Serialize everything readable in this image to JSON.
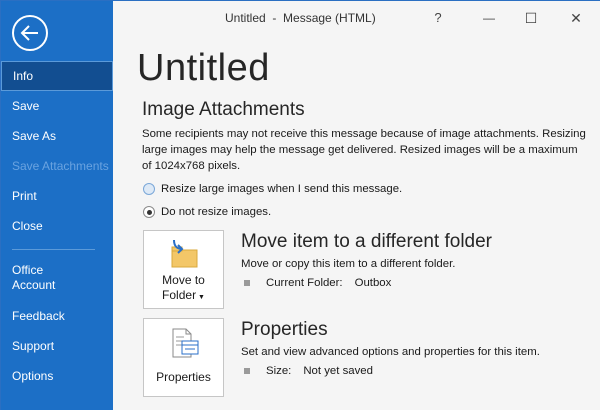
{
  "window": {
    "title": "Untitled  -  Message (HTML)",
    "help": "?",
    "minimize": "—",
    "maximize": "☐",
    "close": "✕"
  },
  "sidebar": {
    "items": [
      {
        "label": "Info"
      },
      {
        "label": "Save"
      },
      {
        "label": "Save As"
      },
      {
        "label": "Save Attachments"
      },
      {
        "label": "Print"
      },
      {
        "label": "Close"
      },
      {
        "label": "Office\nAccount"
      },
      {
        "label": "Feedback"
      },
      {
        "label": "Support"
      },
      {
        "label": "Options"
      }
    ]
  },
  "main": {
    "page_title": "Untitled",
    "image_attachments": {
      "heading": "Image Attachments",
      "description": "Some recipients may not receive this message because of image attachments. Resizing large images may help the message get delivered. Resized images will be a maximum of 1024x768 pixels.",
      "option_resize": "Resize large images when I send this message.",
      "option_no_resize": "Do not resize images."
    },
    "move": {
      "button_label_line1": "Move to",
      "button_label_line2": "Folder",
      "heading": "Move item to a different folder",
      "description": "Move or copy this item to a different folder.",
      "info_label": "Current Folder:",
      "info_value": "Outbox"
    },
    "properties": {
      "button_label": "Properties",
      "heading": "Properties",
      "description": "Set and view advanced options and properties for this item.",
      "info_label": "Size:",
      "info_value": "Not yet saved"
    }
  },
  "colors": {
    "sidebar": "#1c6fc6",
    "sidebar_selected": "#124e91",
    "main_bg": "#f5f5f5"
  }
}
